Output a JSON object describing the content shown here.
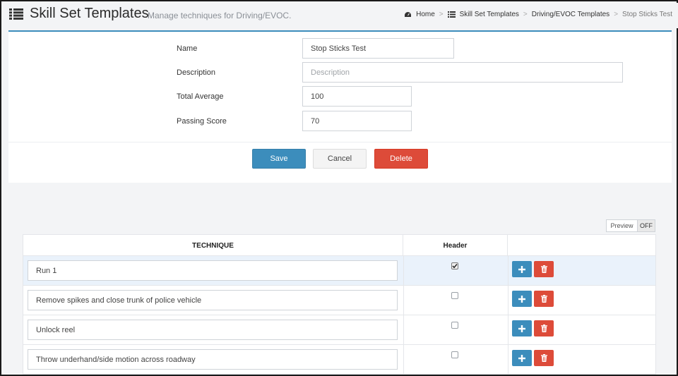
{
  "header": {
    "title": "Skill Set Templates",
    "subtitle": "Manage techniques for Driving/EVOC."
  },
  "breadcrumb": {
    "items": [
      {
        "label": "Home",
        "icon": "dashboard-icon"
      },
      {
        "label": "Skill Set Templates",
        "icon": "list-icon"
      },
      {
        "label": "Driving/EVOC Templates"
      },
      {
        "label": "Stop Sticks Test"
      }
    ]
  },
  "form": {
    "name_label": "Name",
    "name_value": "Stop Sticks Test",
    "description_label": "Description",
    "description_placeholder": "Description",
    "description_value": "",
    "total_average_label": "Total Average",
    "total_average_value": "100",
    "passing_score_label": "Passing Score",
    "passing_score_value": "70"
  },
  "actions": {
    "save_label": "Save",
    "cancel_label": "Cancel",
    "delete_label": "Delete"
  },
  "preview": {
    "label": "Preview",
    "state": "OFF"
  },
  "table": {
    "columns": [
      "TECHNIQUE",
      "Header",
      ""
    ],
    "rows": [
      {
        "technique": "Run 1",
        "header": true
      },
      {
        "technique": "Remove spikes and close trunk of police vehicle",
        "header": false
      },
      {
        "technique": "Unlock reel",
        "header": false
      },
      {
        "technique": "Throw underhand/side motion across roadway",
        "header": false
      }
    ]
  },
  "colors": {
    "primary": "#3c8dbc",
    "danger": "#dd4b39",
    "row_highlight": "#eaf2fb"
  }
}
